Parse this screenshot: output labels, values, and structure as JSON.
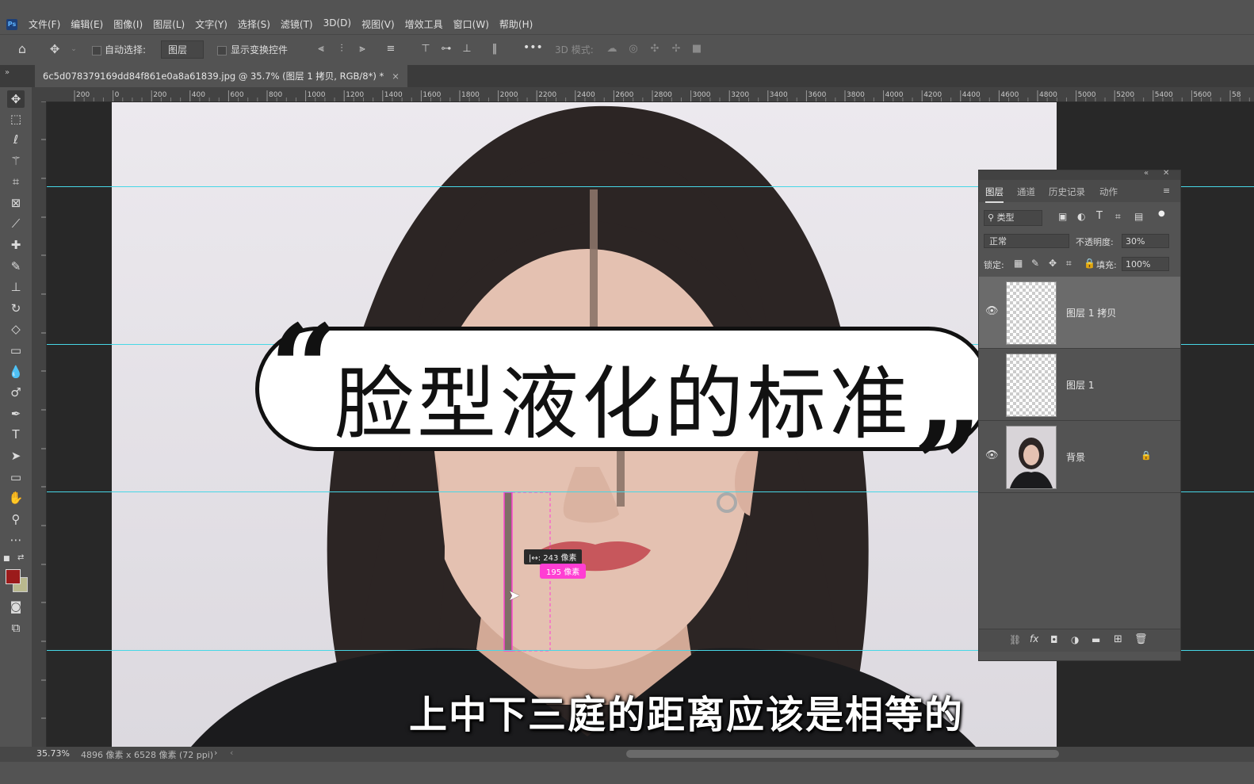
{
  "menu": {
    "app_logo": "Ps",
    "items": [
      "文件(F)",
      "编辑(E)",
      "图像(I)",
      "图层(L)",
      "文字(Y)",
      "选择(S)",
      "滤镜(T)",
      "3D(D)",
      "视图(V)",
      "增效工具",
      "窗口(W)",
      "帮助(H)"
    ]
  },
  "options": {
    "auto_select_label": "自动选择:",
    "auto_select_value": "图层",
    "show_transform_label": "显示变换控件",
    "more": "•••",
    "mode_3d_label": "3D 模式:"
  },
  "document": {
    "tab_title": "6c5d078379169dd84f861e0a8a61839.jpg @ 35.7% (图层 1 拷贝, RGB/8*) *",
    "close_glyph": "×"
  },
  "ruler": {
    "top_ticks": [
      "200",
      "0",
      "200",
      "400",
      "600",
      "800",
      "1000",
      "1200",
      "1400",
      "1600",
      "1800",
      "2000",
      "2200",
      "2400",
      "2600",
      "2800",
      "3000",
      "3200",
      "3400",
      "3600",
      "3800",
      "4000",
      "4200",
      "4400",
      "4600",
      "4800",
      "5000",
      "5200",
      "5400",
      "5600",
      "58"
    ]
  },
  "measure": {
    "line1": "|↔: 243 像素",
    "line2": "195 像素"
  },
  "overlay": {
    "title": "脸型液化的标准",
    "open_quote": "“",
    "close_quote": "”",
    "subtitle": "上中下三庭的距离应该是相等的"
  },
  "status": {
    "zoom": "35.73%",
    "doc_info": "4896 像素 x 6528 像素 (72 ppi)",
    "nav_arrow": "›",
    "nav_arrow_left": "‹"
  },
  "layers_panel": {
    "tabs": [
      "图层",
      "通道",
      "历史记录",
      "动作"
    ],
    "filter_label": "类型",
    "blend_mode": "正常",
    "opacity_label": "不透明度:",
    "opacity_value": "30%",
    "lock_label": "锁定:",
    "fill_label": "填充:",
    "fill_value": "100%",
    "layers": [
      {
        "name": "图层 1 拷贝",
        "visible": true,
        "selected": true
      },
      {
        "name": "图层 1",
        "visible": false,
        "selected": false
      },
      {
        "name": "背景",
        "visible": true,
        "selected": false,
        "locked": true
      }
    ],
    "footer_fx": "fx"
  },
  "colors": {
    "foreground": "#9b1b1b",
    "background": "#b9b98e",
    "guide": "#47d7e6",
    "measure_badge": "#ff3ed3"
  }
}
